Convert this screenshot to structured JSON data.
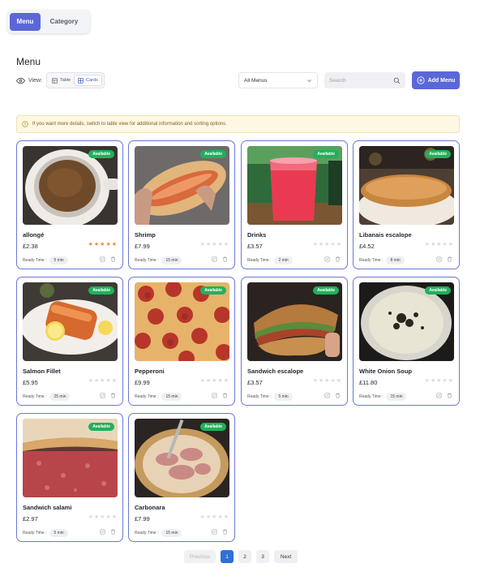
{
  "header": {
    "tabs": [
      {
        "label": "Menu",
        "active": true
      },
      {
        "label": "Category",
        "active": false
      }
    ],
    "title": "Menu"
  },
  "toolbar": {
    "view_label": "View:",
    "view_options": [
      {
        "label": "Table",
        "icon": "table-icon",
        "active": false
      },
      {
        "label": "Cards",
        "icon": "grid-icon",
        "active": true
      }
    ],
    "filter_value": "All Menus",
    "search_placeholder": "Search",
    "add_label": "Add Menu"
  },
  "info": {
    "text": "If you want more details, switch to table view for additional information and sorting options."
  },
  "cards": [
    {
      "name": "allongé",
      "price": "£2.38",
      "rating": 5,
      "ready_label": "Ready Time :",
      "time": "5 min",
      "badge": "Available",
      "image": "coffee"
    },
    {
      "name": "Shrimp",
      "price": "£7.99",
      "rating": 0,
      "ready_label": "Ready Time :",
      "time": "15 min",
      "badge": "Available",
      "image": "shrimp"
    },
    {
      "name": "Drinks",
      "price": "£3.57",
      "rating": 0,
      "ready_label": "Ready Time :",
      "time": "2 min",
      "badge": "Available",
      "image": "drink"
    },
    {
      "name": "Libanais escalope",
      "price": "£4.52",
      "rating": 0,
      "ready_label": "Ready Time :",
      "time": "8 min",
      "badge": "Available",
      "image": "escalope"
    },
    {
      "name": "Salmon Fillet",
      "price": "£5.95",
      "rating": 0,
      "ready_label": "Ready Time :",
      "time": "25 min",
      "badge": "Available",
      "image": "salmon"
    },
    {
      "name": "Pepperoni",
      "price": "£9.99",
      "rating": 0,
      "ready_label": "Ready Time :",
      "time": "15 min",
      "badge": "Available",
      "image": "pizza"
    },
    {
      "name": "Sandwich escalope",
      "price": "£3.57",
      "rating": 0,
      "ready_label": "Ready Time :",
      "time": "5 min",
      "badge": "Available",
      "image": "sandwich"
    },
    {
      "name": "White Onion Soup",
      "price": "£11.80",
      "rating": 0,
      "ready_label": "Ready Time :",
      "time": "15 min",
      "badge": "Available",
      "image": "soup"
    },
    {
      "name": "Sandwich salami",
      "price": "£2.97",
      "rating": 0,
      "ready_label": "Ready Time :",
      "time": "5 min",
      "badge": "Available",
      "image": "salami"
    },
    {
      "name": "Carbonara",
      "price": "£7.99",
      "rating": 0,
      "ready_label": "Ready Time :",
      "time": "15 min",
      "badge": "Available",
      "image": "carbonara"
    }
  ],
  "pagination": {
    "prev": "Previous",
    "pages": [
      "1",
      "2",
      "3"
    ],
    "current": "1",
    "next": "Next"
  },
  "colors": {
    "accent": "#5b67d8",
    "available": "#21b05c",
    "star_on": "#f08a3e",
    "card_border": "#6b77d9"
  }
}
